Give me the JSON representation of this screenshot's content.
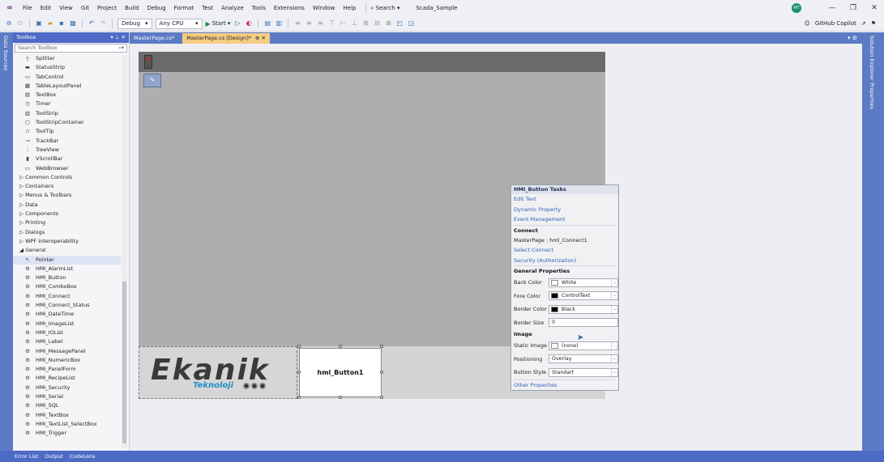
{
  "menubar": {
    "items": [
      "File",
      "Edit",
      "View",
      "Git",
      "Project",
      "Build",
      "Debug",
      "Format",
      "Test",
      "Analyze",
      "Tools",
      "Extensions",
      "Window",
      "Help"
    ],
    "search_label": "Search",
    "solution_name": "Scada_Sample",
    "avatar_initials": "MT"
  },
  "toolbar": {
    "config": "Debug",
    "platform": "Any CPU",
    "start_label": "Start",
    "copilot_label": "GitHub Copilot"
  },
  "left_strip": {
    "label": "Data Sources"
  },
  "toolbox": {
    "title": "Toolbox",
    "search_placeholder": "Search Toolbox",
    "items": [
      {
        "label": "Splitter",
        "icon": "·|·",
        "type": "item"
      },
      {
        "label": "StatusStrip",
        "icon": "▬",
        "type": "item"
      },
      {
        "label": "TabControl",
        "icon": "▭",
        "type": "item"
      },
      {
        "label": "TableLayoutPanel",
        "icon": "▦",
        "type": "item"
      },
      {
        "label": "TextBox",
        "icon": "▤",
        "type": "item"
      },
      {
        "label": "Timer",
        "icon": "◷",
        "type": "item"
      },
      {
        "label": "ToolStrip",
        "icon": "▥",
        "type": "item"
      },
      {
        "label": "ToolStripContainer",
        "icon": "▢",
        "type": "item"
      },
      {
        "label": "ToolTip",
        "icon": "▫",
        "type": "item"
      },
      {
        "label": "TrackBar",
        "icon": "⊸",
        "type": "item"
      },
      {
        "label": "TreeView",
        "icon": "⋮",
        "type": "item"
      },
      {
        "label": "VScrollBar",
        "icon": "▮",
        "type": "item"
      },
      {
        "label": "WebBrowser",
        "icon": "▭",
        "type": "item"
      },
      {
        "label": "▷ Common Controls",
        "icon": "",
        "type": "cat"
      },
      {
        "label": "▷ Containers",
        "icon": "",
        "type": "cat"
      },
      {
        "label": "▷ Menus & Toolbars",
        "icon": "",
        "type": "cat"
      },
      {
        "label": "▷ Data",
        "icon": "",
        "type": "cat"
      },
      {
        "label": "▷ Components",
        "icon": "",
        "type": "cat"
      },
      {
        "label": "▷ Printing",
        "icon": "",
        "type": "cat"
      },
      {
        "label": "▷ Dialogs",
        "icon": "",
        "type": "cat"
      },
      {
        "label": "▷ WPF Interoperability",
        "icon": "",
        "type": "cat"
      },
      {
        "label": "◢ General",
        "icon": "",
        "type": "cat"
      },
      {
        "label": "Pointer",
        "icon": "↖",
        "type": "selected"
      },
      {
        "label": "HMI_AlarmList",
        "icon": "⚙",
        "type": "item"
      },
      {
        "label": "HMI_Button",
        "icon": "⚙",
        "type": "item"
      },
      {
        "label": "HMI_ComboBox",
        "icon": "⚙",
        "type": "item"
      },
      {
        "label": "HMI_Connect",
        "icon": "⚙",
        "type": "item"
      },
      {
        "label": "HMI_Connect_Status",
        "icon": "⚙",
        "type": "item"
      },
      {
        "label": "HMI_DateTime",
        "icon": "⚙",
        "type": "item"
      },
      {
        "label": "HMI_ImageList",
        "icon": "⚙",
        "type": "item"
      },
      {
        "label": "HMI_IOList",
        "icon": "⚙",
        "type": "item"
      },
      {
        "label": "HMI_Label",
        "icon": "⚙",
        "type": "item"
      },
      {
        "label": "HMI_MessagePanel",
        "icon": "⚙",
        "type": "item"
      },
      {
        "label": "HMI_NumericBox",
        "icon": "⚙",
        "type": "item"
      },
      {
        "label": "HMI_PanelForm",
        "icon": "⚙",
        "type": "item"
      },
      {
        "label": "HMI_RecipeList",
        "icon": "⚙",
        "type": "item"
      },
      {
        "label": "HMI_Security",
        "icon": "⚙",
        "type": "item"
      },
      {
        "label": "HMI_Serial",
        "icon": "⚙",
        "type": "item"
      },
      {
        "label": "HMI_SQL",
        "icon": "⚙",
        "type": "item"
      },
      {
        "label": "HMI_TextBox",
        "icon": "⚙",
        "type": "item"
      },
      {
        "label": "HMI_TextList_SelectBox",
        "icon": "⚙",
        "type": "item"
      },
      {
        "label": "HMI_Trigger",
        "icon": "⚙",
        "type": "item"
      }
    ]
  },
  "tabs": [
    {
      "label": "MasterPage.cs*",
      "active": false,
      "suffix": ""
    },
    {
      "label": "MasterPage.cs [Design]*",
      "active": true,
      "suffix": "⊕ ✕"
    }
  ],
  "design": {
    "logo_text": "Ekanik",
    "logo_sub": "Teknoloji",
    "button_text": "hml_Button1"
  },
  "tasks": {
    "title": "HMI_Button Tasks",
    "links_top": [
      "Edit Text",
      "Dynamic Property",
      "Event Management"
    ],
    "connect_header": "Connect",
    "connect_value": "MasterPage : hml_Connect1",
    "links_mid": [
      "Select Connect",
      "Security (Authorization)"
    ],
    "general_header": "General Properties",
    "props": [
      {
        "label": "Back Color",
        "value": "White",
        "swatch": "#ffffff",
        "arrow": "⌄"
      },
      {
        "label": "Fore Color",
        "value": "ControlText",
        "swatch": "#000000",
        "arrow": "⌄"
      },
      {
        "label": "Border Color",
        "value": "Black",
        "swatch": "#000000",
        "arrow": "⌄"
      }
    ],
    "border_size_label": "Border Size",
    "border_size_value": "0",
    "image_header": "Image",
    "image_props": [
      {
        "label": "Static Image",
        "value": "(none)",
        "swatch": "#ffffff",
        "arrow": "…"
      },
      {
        "label": "Positioning",
        "value": "Overlay",
        "swatch": "",
        "arrow": "⌄"
      },
      {
        "label": "Button Style",
        "value": "Standart",
        "swatch": "",
        "arrow": "⌄"
      }
    ],
    "other_link": "Other Properties"
  },
  "right_strip": {
    "labels": [
      "Solution Explorer",
      "Properties"
    ]
  },
  "statusbar": {
    "items": [
      "Error List",
      "Output",
      "CodeLens"
    ]
  }
}
